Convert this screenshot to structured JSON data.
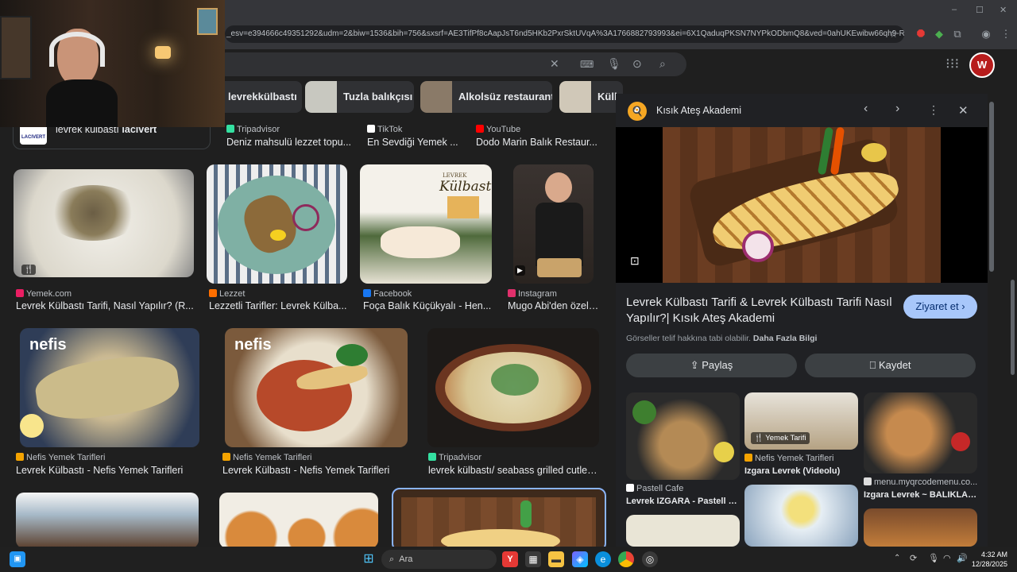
{
  "browser": {
    "url": "_esv=e394666c49351292&udm=2&biw=1536&bih=756&sxsrf=AE3TifPf8cAapJsT6nd5HKb2PxrSktUVqA%3A1766882793993&ei=6X1QaduqPKSN7NYPkODbmQ8&ved=0ahUKEwibw66qh9-RAxWk8ts...",
    "window_controls": [
      "–",
      "☐",
      "✕"
    ]
  },
  "search": {
    "query": ""
  },
  "chips": [
    {
      "label": "levrekkülbastı",
      "color": "#6b5a48"
    },
    {
      "label": "Tuzla balıkçısı",
      "color": "#c8c8c0"
    },
    {
      "label": "Alkolsüz restaurant",
      "color": "#8a7a68"
    },
    {
      "label": "Külb",
      "color": "#d0c8b8"
    }
  ],
  "top_row": {
    "lacivert_label": "levrek külbastı",
    "lacivert_bold": "lacivert",
    "lacivert_logo": "LACIVERT",
    "items": [
      {
        "source": "Tripadvisor",
        "title": "Deniz mahsulü lezzet topu...",
        "fav": "#34e0a1"
      },
      {
        "source": "TikTok",
        "title": "En Sevdiği Yemek ...",
        "fav": "#ffffff"
      },
      {
        "source": "YouTube",
        "title": "Dodo Marin Balık Restaur...",
        "fav": "#ff0000"
      }
    ]
  },
  "row1": [
    {
      "source": "Yemek.com",
      "title": "Levrek Külbastı Tarifi, Nasıl Yapılır? (R...",
      "fav": "#e91e63"
    },
    {
      "source": "Lezzet",
      "title": "Lezzetli Tarifler: Levrek Külba...",
      "fav": "#ff6f00"
    },
    {
      "source": "Facebook",
      "title": "Foça Balık Küçükyalı - Hen...",
      "fav": "#1877f2",
      "overlay": "Külbastı",
      "overlay_top": "LEVREK"
    },
    {
      "source": "Instagram",
      "title": "Mugo Abi'den özel ...",
      "fav": "#e1306c"
    }
  ],
  "row2": [
    {
      "source": "Nefis Yemek Tarifleri",
      "title": "Levrek Külbastı - Nefis Yemek Tarifleri",
      "fav": "#f4a300",
      "brand": "nefis"
    },
    {
      "source": "Nefis Yemek Tarifleri",
      "title": "Levrek Külbastı - Nefis Yemek Tarifleri",
      "fav": "#f4a300",
      "brand": "nefis"
    },
    {
      "source": "Tripadvisor",
      "title": "levrek külbastı/ seabass grilled cutlet ...",
      "fav": "#34e0a1"
    }
  ],
  "panel": {
    "site": "Kısık Ateş Akademi",
    "title": "Levrek Külbastı Tarifi & Levrek Külbastı Tarifi Nasıl Yapılır?| Kısık Ateş Akademi",
    "copyright": "Görseller telif hakkına tabi olabilir.",
    "more_info": "Daha Fazla Bilgi",
    "visit": "Ziyaret et",
    "share": "Paylaş",
    "save": "Kaydet",
    "related": [
      {
        "source": "Pastell Cafe",
        "title": "Levrek IZGARA - Pastell Cafe",
        "fav": "#ffffff"
      },
      {
        "source": "Nefis Yemek Tarifleri",
        "title": "Izgara Levrek (Videolu)",
        "fav": "#f4a300",
        "tag": "Yemek Tarifi"
      },
      {
        "source": "menu.myqrcodemenu.co...",
        "title": "Izgara Levrek ~ BALIKLAR -...",
        "fav": "#dddddd"
      }
    ]
  },
  "taskbar": {
    "search": "Ara",
    "time": "4:32 AM",
    "date": "12/28/2025"
  }
}
